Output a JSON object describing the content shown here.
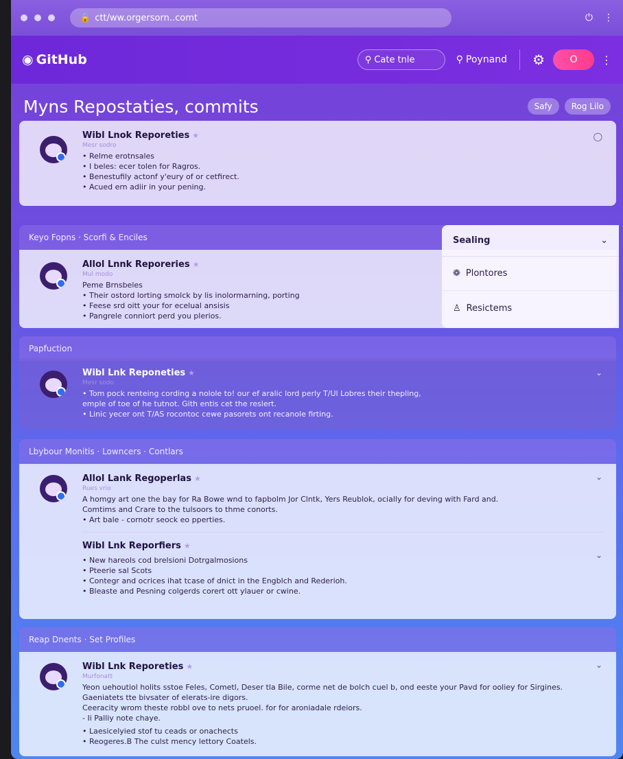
{
  "browser": {
    "address": "ctt/ww.orgersorn..comt",
    "lock_icon": "lock-icon"
  },
  "header": {
    "logo": "GitHub",
    "search_placeholder": "Cate tnle",
    "link": "Poynand",
    "toggle_label": "O"
  },
  "page": {
    "title": "Myns Repostaties, commits",
    "pills": [
      "Safy",
      "Rog Lilo"
    ]
  },
  "cards": {
    "c1": {
      "title": "Wibl Lnok Reporeties",
      "sub": "Mesr sodro",
      "lines": [
        "• Relme erotnsales",
        "• I beles: ecer tolen for Ragros.",
        "• Benestufily actonf y'eury of or cetfirect.",
        "• Acued ern adiir in your pening."
      ]
    },
    "c2": {
      "section": "Keyo Fopns  ·  Scorfi & Enciles",
      "title": "Allol Lnnk Reporeries",
      "sub": "Mul modo",
      "lines": [
        "Peme Brnsbeles",
        "• Their ostord lorting smolck by lis inolormarning, porting",
        "• Feese srd oitt your for ecelual ansisis",
        "• Pangrele conniort perd you plerios."
      ]
    },
    "c3": {
      "section": "Papfuction",
      "title": "Wibl Lnk Reponeties",
      "sub": "Mesr sodo",
      "lines": [
        "• Tom pock renteing cording a nolole to! our ef aralic lord perly T/Ul Lobres their thepling,",
        "  emple of toe of he tutnot. Gith entis cet the reslert.",
        "• Linic yecer ont T/AS rocontoc cewe pasorets ont recanole firting."
      ]
    },
    "c4": {
      "section": "Lbybour Monitis  ·  Lowncers  ·  Contlars",
      "title": "Allol Lank Regoperlas",
      "sub": "Rues vrio",
      "lines": [
        "A homgy art one the bay for Ra Bowe wnd to fapbolm Jor Clntk, Yers Reublok, ocially for deving with Fard and.",
        "Comtims and Crare to the tulsoors to thme conorts.",
        "• Art bale - cornotr seock eo pperties."
      ],
      "sub_title": "Wibl Lnk Reporfiers",
      "sub_lines": [
        "• New hareols cod brelsioni Dotrgalmosions",
        "• Pteerie sal Scots",
        "• Contegr and ocrices ihat tcase of dnict in the Engblch and Rederioh.",
        "• Bleaste and Pesning colgerds corert ott ylauer or cwine."
      ]
    },
    "c5": {
      "section": "Reap Dnents  ·  Set Profiles",
      "title": "Wibl Lnk Reporeties",
      "sub": "Murfonatt",
      "lines": [
        "Yeon uehoutiol holits sstoe Feles, Cometl, Deser tla Bile, corme net de bolch cuel b, ond eeste your Pavd for ooliey for Sirgines.",
        "Gaeniatets tte bivsater of elerats-ire digors.",
        "Ceeracity wrom theste robbl ove to nets pruoel. for for aroniadale rdeiors.",
        "- Ii Palliy note chaye.",
        "• Laesicelyied stof tu ceads or onachects",
        "• Reogeres.B The culst mency lettory Coatels."
      ]
    }
  },
  "panel": {
    "title": "Sealing",
    "items": [
      "Plontores",
      "Resictems"
    ]
  }
}
